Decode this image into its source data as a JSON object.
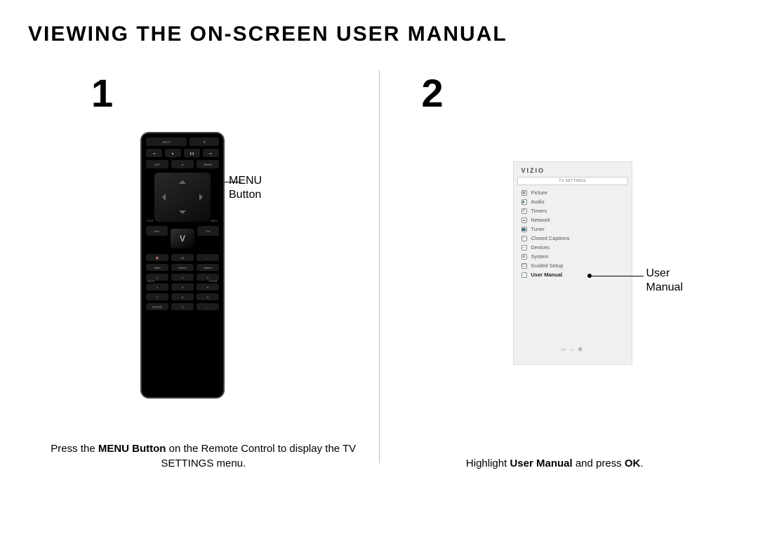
{
  "title": "VIEWING THE ON-SCREEN USER MANUAL",
  "step1": {
    "number": "1",
    "callout_l1": "MENU",
    "callout_l2": "Button",
    "caption_pre": "Press the ",
    "caption_bold1": "MENU Button",
    "caption_mid": " on the Remote Control to display the TV SETTINGS menu.",
    "remote": {
      "row1": {
        "input": "INPUT",
        "power": "⏻"
      },
      "transport": {
        "rew": "◂◂",
        "play": "▶",
        "pause": "❚❚",
        "ff": "▸▸"
      },
      "row3": {
        "list": "LIST",
        "rec": "●",
        "menu": "MENU"
      },
      "labels": {
        "exit": "EXIT",
        "info": "INFO",
        "back": "BACK",
        "guide": "GUIDE"
      },
      "mid": {
        "vol": "VOL",
        "v": "V",
        "ch": "CH"
      },
      "row_mute": {
        "mute": "🔇",
        "last": "3D",
        "cc": "—"
      },
      "row_hotkeys": {
        "a": "Wide",
        "b": "Stereo",
        "c": "Option"
      },
      "keypad": [
        "1",
        "2",
        "3",
        "4",
        "5",
        "6",
        "7",
        "8",
        "9"
      ],
      "row_bottom": {
        "enter": "ENTER",
        "zero": "0",
        "dash": "—"
      }
    }
  },
  "step2": {
    "number": "2",
    "callout_l1": "User",
    "callout_l2": "Manual",
    "caption_pre": "Highlight ",
    "caption_bold1": "User Manual",
    "caption_mid": " and press ",
    "caption_bold2": "OK",
    "caption_post": ".",
    "menu": {
      "brand": "VIZIO",
      "header": "TV SETTINGS",
      "items": [
        {
          "icon": "▦",
          "label": "Picture"
        },
        {
          "icon": "🔊",
          "label": "Audio"
        },
        {
          "icon": "⏱",
          "label": "Timers"
        },
        {
          "icon": "☁",
          "label": "Network"
        },
        {
          "icon": "📺",
          "label": "Tuner"
        },
        {
          "icon": "▭",
          "label": "Closed Captions"
        },
        {
          "icon": "—",
          "label": "Devices"
        },
        {
          "icon": "✿",
          "label": "System"
        },
        {
          "icon": "🖵",
          "label": "Guided Setup"
        },
        {
          "icon": "📄",
          "label": "User Manual"
        }
      ],
      "footer": "▭ ⌄ ✿"
    }
  }
}
